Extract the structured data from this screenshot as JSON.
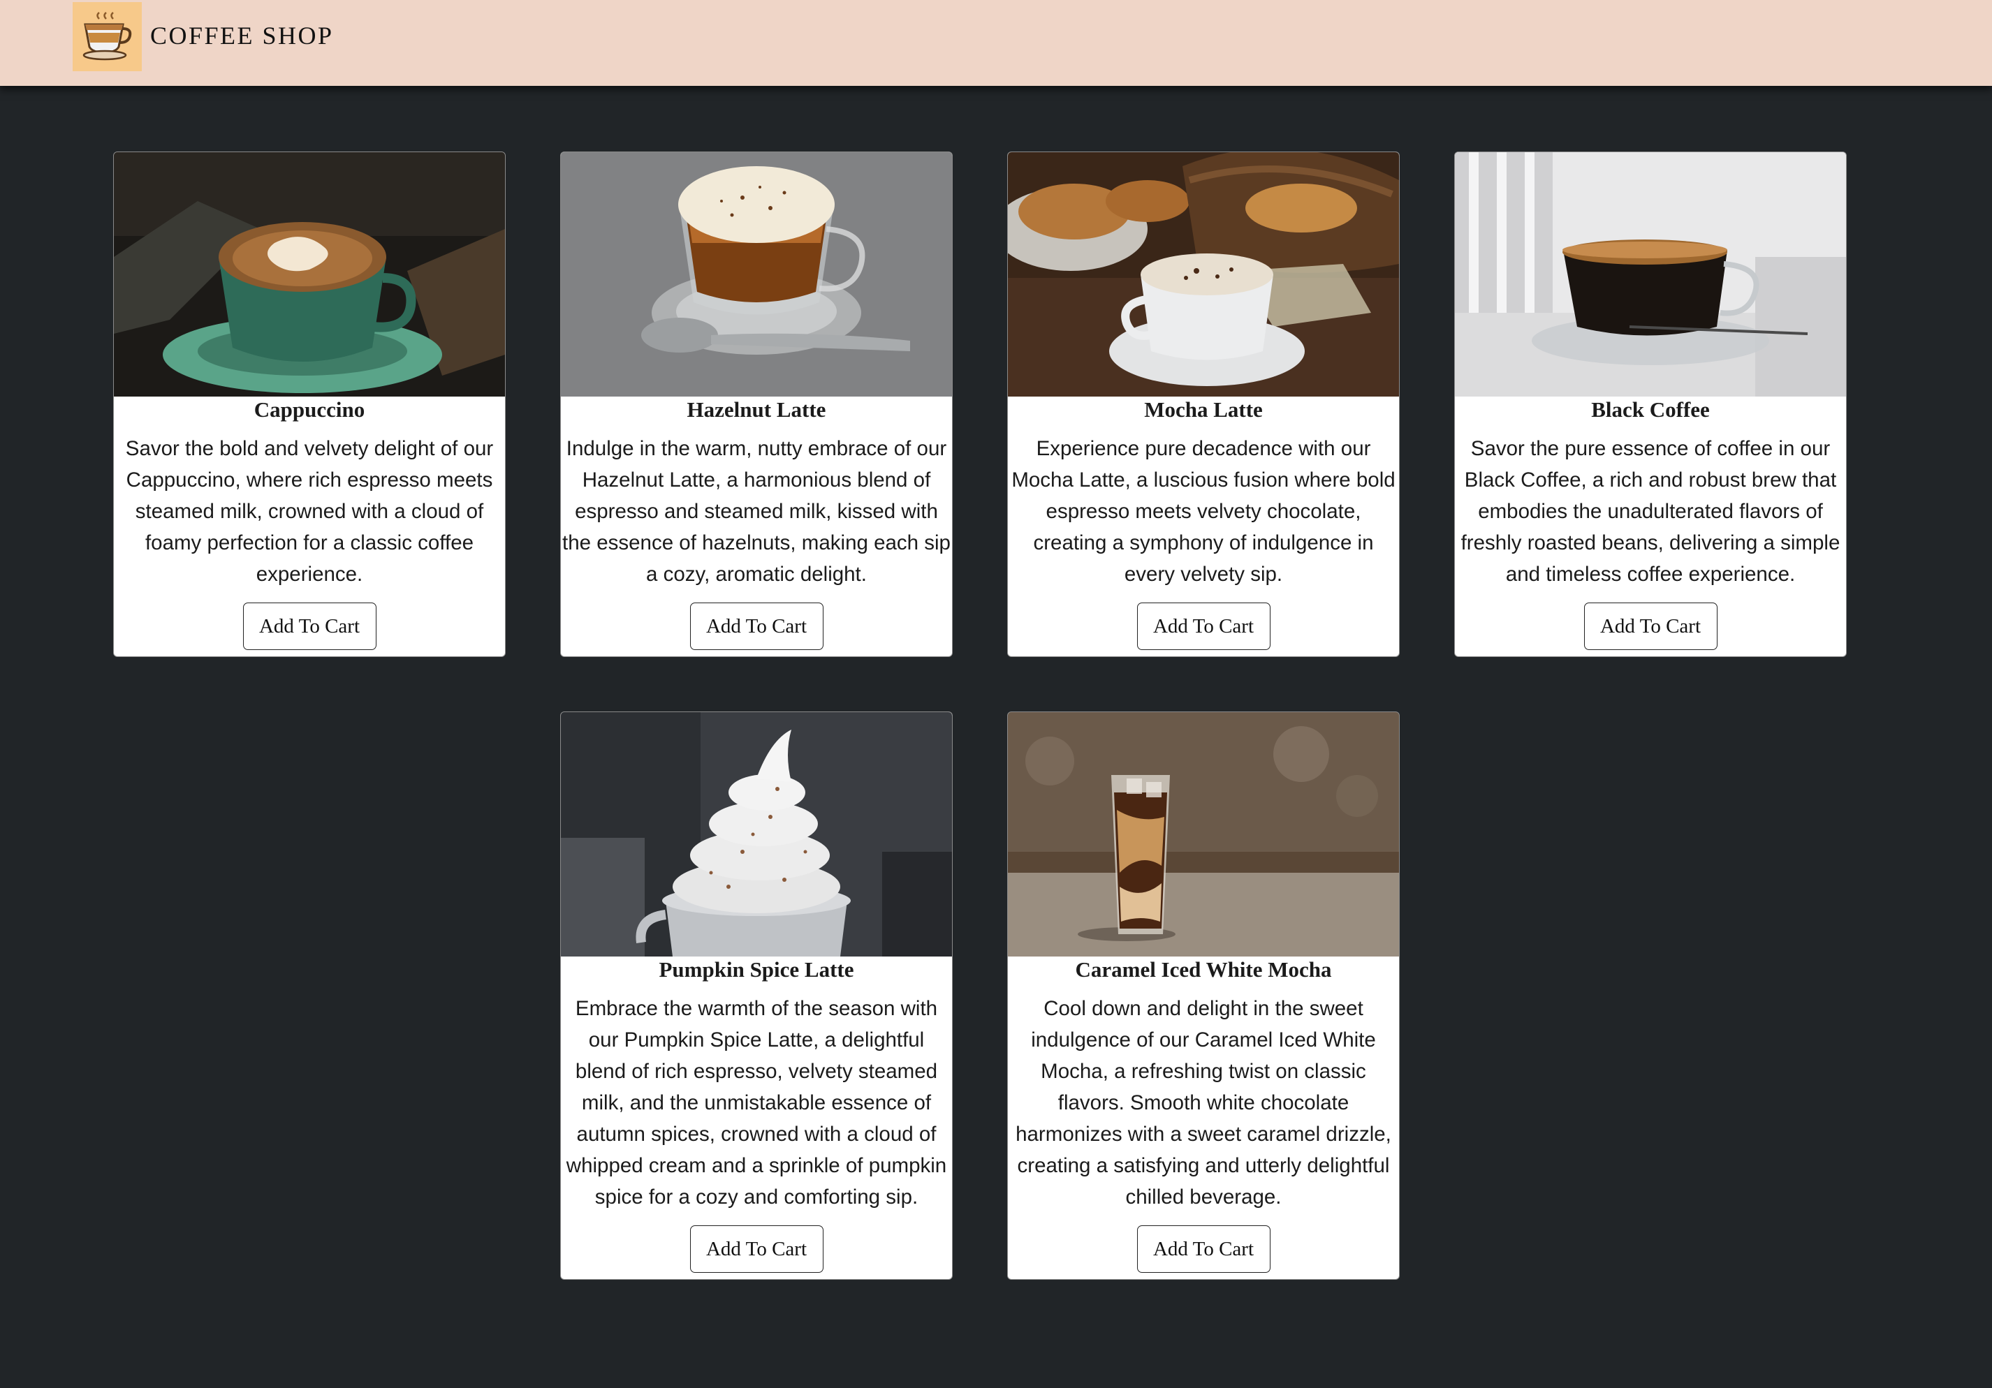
{
  "header": {
    "brand": "COFFEE SHOP"
  },
  "products": [
    {
      "name": "Cappuccino",
      "description": "Savor the bold and velvety delight of our Cappuccino, where rich espresso meets steamed milk, crowned with a cloud of foamy perfection for a classic coffee experience.",
      "button": "Add To Cart"
    },
    {
      "name": "Hazelnut Latte",
      "description": "Indulge in the warm, nutty embrace of our Hazelnut Latte, a harmonious blend of espresso and steamed milk, kissed with the essence of hazelnuts, making each sip a cozy, aromatic delight.",
      "button": "Add To Cart"
    },
    {
      "name": "Mocha Latte",
      "description": "Experience pure decadence with our Mocha Latte, a luscious fusion where bold espresso meets velvety chocolate, creating a symphony of indulgence in every velvety sip.",
      "button": "Add To Cart"
    },
    {
      "name": "Black Coffee",
      "description": "Savor the pure essence of coffee in our Black Coffee, a rich and robust brew that embodies the unadulterated flavors of freshly roasted beans, delivering a simple and timeless coffee experience.",
      "button": "Add To Cart"
    },
    {
      "name": "Pumpkin Spice Latte",
      "description": "Embrace the warmth of the season with our Pumpkin Spice Latte, a delightful blend of rich espresso, velvety steamed milk, and the unmistakable essence of autumn spices, crowned with a cloud of whipped cream and a sprinkle of pumpkin spice for a cozy and comforting sip.",
      "button": "Add To Cart"
    },
    {
      "name": "Caramel Iced White Mocha",
      "description": "Cool down and delight in the sweet indulgence of our Caramel Iced White Mocha, a refreshing twist on classic flavors. Smooth white chocolate harmonizes with a sweet caramel drizzle, creating a satisfying and utterly delightful chilled beverage.",
      "button": "Add To Cart"
    }
  ],
  "colors": {
    "header_bg": "#efd5c7",
    "page_bg": "#212528",
    "logo_bg": "#f7c98a"
  },
  "icons": {
    "logo": "coffee-cup-icon"
  }
}
